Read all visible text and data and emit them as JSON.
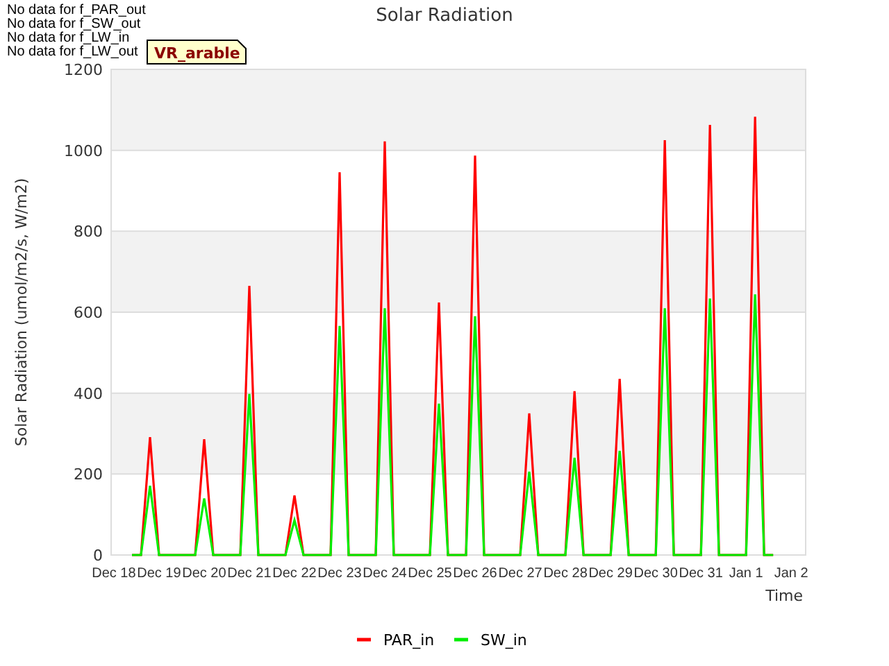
{
  "messages": [
    "No data for f_PAR_out",
    "No data for f_SW_out",
    "No data for f_LW_in",
    "No data for f_LW_out"
  ],
  "tooltip": {
    "text": "VR_arable"
  },
  "chart": {
    "chart_data": {
      "type": "line",
      "title": "Solar Radiation",
      "xlabel": "Time",
      "ylabel": "Solar Radiation (umol/m2/s, W/m2)",
      "categories": [
        "Dec 18",
        null,
        null,
        null,
        null,
        "Dec 19",
        null,
        null,
        null,
        null,
        "Dec 20",
        null,
        null,
        null,
        null,
        "Dec 21",
        null,
        null,
        null,
        null,
        "Dec 22",
        null,
        null,
        null,
        null,
        "Dec 23",
        null,
        null,
        null,
        null,
        "Dec 24",
        null,
        null,
        null,
        null,
        "Dec 25",
        null,
        null,
        null,
        null,
        "Dec 26",
        null,
        null,
        null,
        null,
        "Dec 27",
        null,
        null,
        null,
        null,
        "Dec 28",
        null,
        null,
        null,
        null,
        "Dec 29",
        null,
        null,
        null,
        null,
        "Dec 30",
        null,
        null,
        null,
        null,
        "Dec 31",
        null,
        null,
        null,
        null,
        "Jan 1",
        null,
        null,
        null,
        null,
        "Jan 2"
      ],
      "series": [
        {
          "name": "PAR_in",
          "color": "#ff0000",
          "values": [
            null,
            null,
            0,
            0,
            291,
            0,
            0,
            0,
            0,
            0,
            286,
            0,
            0,
            0,
            0,
            665,
            0,
            0,
            0,
            0,
            147,
            0,
            0,
            0,
            0,
            946,
            0,
            0,
            0,
            0,
            1022,
            0,
            0,
            0,
            0,
            0,
            624,
            0,
            0,
            0,
            987,
            0,
            0,
            0,
            0,
            0,
            350,
            0,
            0,
            0,
            0,
            405,
            0,
            0,
            0,
            0,
            435,
            0,
            0,
            0,
            0,
            1025,
            0,
            0,
            0,
            0,
            1063,
            0,
            0,
            0,
            0,
            1083,
            0,
            0,
            null,
            null
          ]
        },
        {
          "name": "SW_in",
          "color": "#00ee00",
          "values": [
            null,
            null,
            0,
            0,
            171,
            0,
            0,
            0,
            0,
            0,
            140,
            0,
            0,
            0,
            0,
            398,
            0,
            0,
            0,
            0,
            86,
            0,
            0,
            0,
            0,
            566,
            0,
            0,
            0,
            0,
            610,
            0,
            0,
            0,
            0,
            0,
            374,
            0,
            0,
            0,
            590,
            0,
            0,
            0,
            0,
            0,
            206,
            0,
            0,
            0,
            0,
            240,
            0,
            0,
            0,
            0,
            257,
            0,
            0,
            0,
            0,
            610,
            0,
            0,
            0,
            0,
            634,
            0,
            0,
            0,
            0,
            644,
            0,
            0,
            null,
            null
          ]
        }
      ],
      "ylim": [
        0,
        1200
      ],
      "grid": true,
      "legend": "bottom",
      "yticks": [
        0,
        200,
        400,
        600,
        800,
        1000,
        1200
      ]
    }
  }
}
